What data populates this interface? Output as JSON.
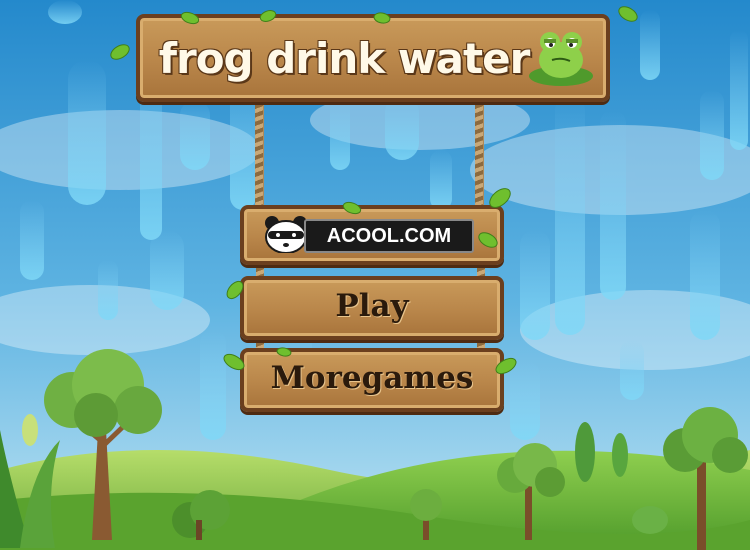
{
  "game": {
    "title": "frog drink water"
  },
  "menu": {
    "sponsor_label": "ACOOL.COM",
    "play_label": "Play",
    "moregames_label": "Moregames"
  },
  "icons": {
    "sponsor_logo": "panda-icon",
    "title_mascot": "frog-icon"
  },
  "colors": {
    "sky_top": "#2d8fd0",
    "sky_bottom": "#9fd6ee",
    "wood": "#b9864a",
    "wood_border": "#6b3f1e",
    "grass": "#6cae3a"
  }
}
